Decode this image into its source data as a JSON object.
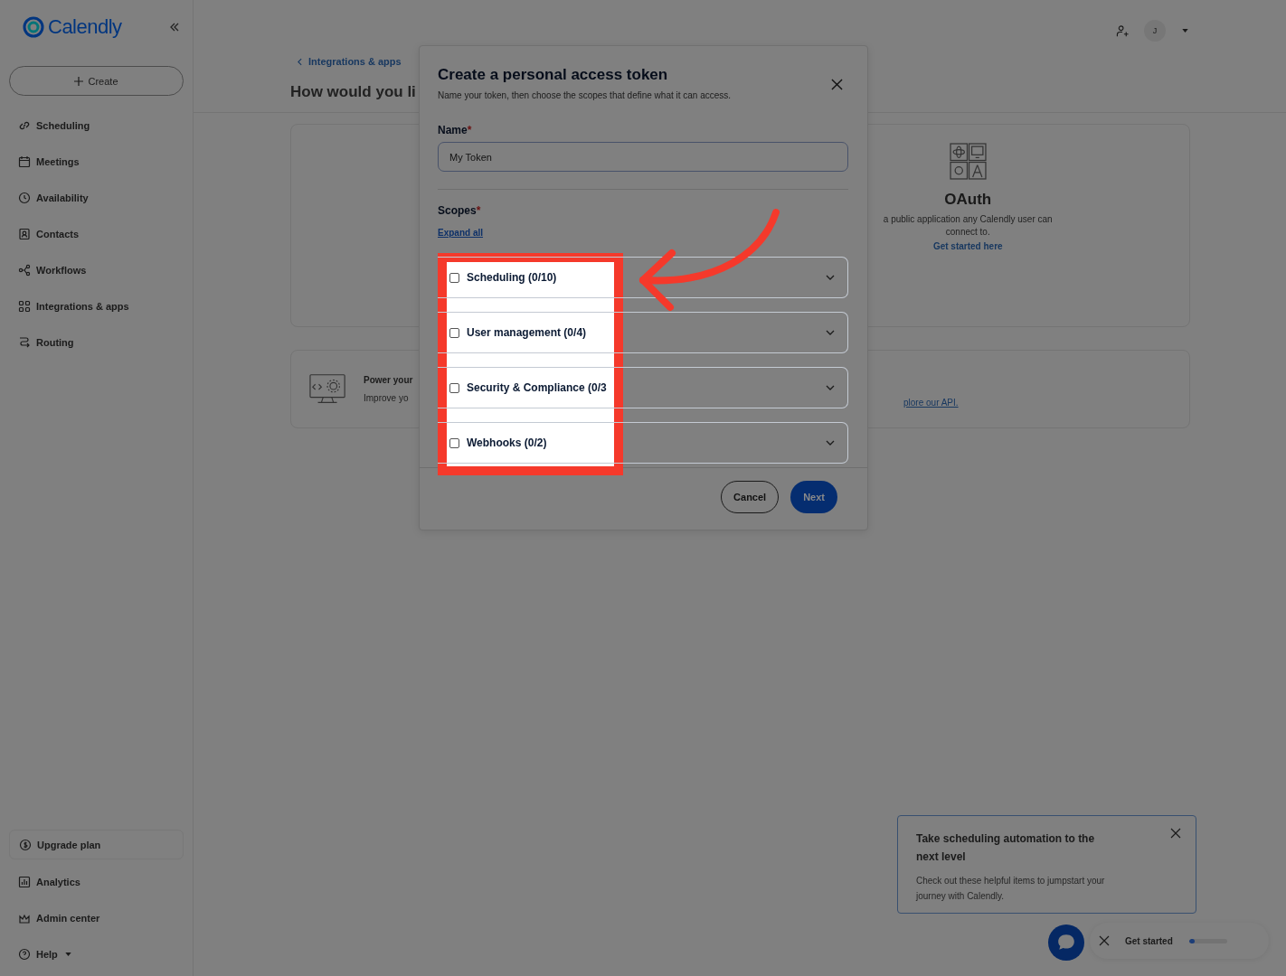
{
  "sidebar": {
    "logo": "Calendly",
    "create": "Create",
    "nav": [
      {
        "label": "Scheduling"
      },
      {
        "label": "Meetings"
      },
      {
        "label": "Availability"
      },
      {
        "label": "Contacts"
      },
      {
        "label": "Workflows"
      },
      {
        "label": "Integrations & apps"
      },
      {
        "label": "Routing"
      }
    ],
    "bottom": [
      {
        "label": "Upgrade plan",
        "kind": "boxed"
      },
      {
        "label": "Analytics",
        "kind": "plain"
      },
      {
        "label": "Admin center",
        "kind": "plain"
      },
      {
        "label": "Help",
        "kind": "menu"
      }
    ]
  },
  "topbar": {
    "avatar": "J"
  },
  "main": {
    "breadcrumb": "Integrations & apps",
    "heading": "How would you li",
    "oauth": {
      "title": "OAuth",
      "lines": [
        "a public application any Calendly user can",
        "connect to."
      ],
      "link": "Get started here"
    },
    "api_card": {
      "title": "Power your",
      "text": "Improve yo",
      "link": "plore our API."
    }
  },
  "modal": {
    "title": "Create a personal access token",
    "subtitle": "Name your token, then choose the scopes that define what it can access.",
    "name_label": "Name",
    "required_mark": "*",
    "name_value": "My Token",
    "scopes_label": "Scopes",
    "scopes_mark": "*",
    "expand_link": "Expand all",
    "scopes": [
      {
        "label": "Scheduling (0/10)",
        "checked": false,
        "expanded": false
      },
      {
        "label": "User management (0/4)",
        "checked": false,
        "expanded": false
      },
      {
        "label": "Security & Compliance (0/3",
        "checked": false,
        "expanded": false
      },
      {
        "label": "Webhooks (0/2)",
        "checked": false,
        "expanded": false
      }
    ],
    "cancel": "Cancel",
    "next": "Next"
  },
  "onboarding": {
    "title": "Take scheduling automation to the next level",
    "text": "Check out these helpful items to jumpstart your journey with Calendly.",
    "button": "Get started",
    "level": 0.15
  }
}
